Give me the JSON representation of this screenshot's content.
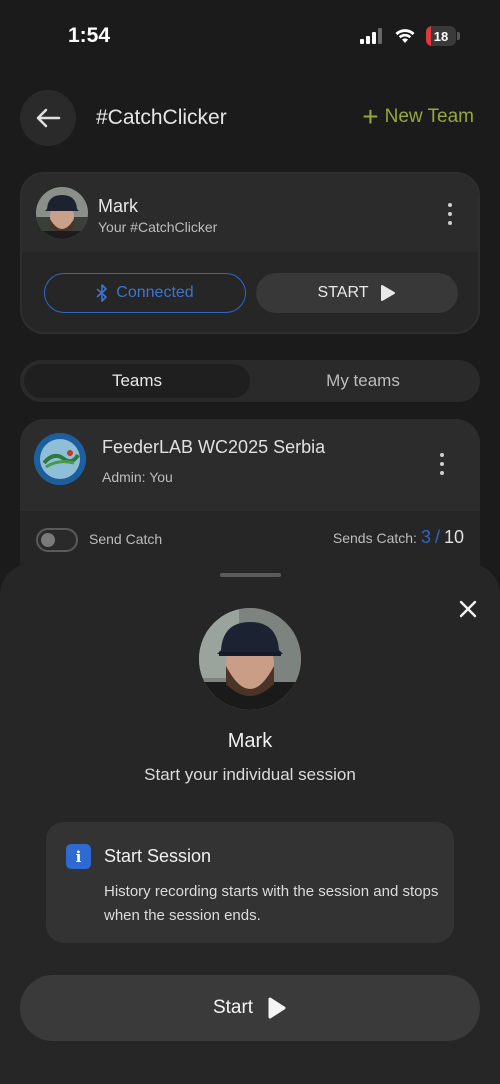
{
  "status_bar": {
    "time": "1:54",
    "battery_level": "18",
    "battery_fraction": 0.18,
    "icons": [
      "signal-icon",
      "wifi-icon",
      "battery-icon"
    ]
  },
  "header": {
    "back_icon": "arrow-left-icon",
    "title": "#CatchClicker",
    "new_team_label": "New Team",
    "accent_color": "#95a83b"
  },
  "user_card": {
    "name": "Mark",
    "subtitle": "Your #CatchClicker",
    "connected_label": "Connected",
    "connected_color": "#2f69c2",
    "start_label": "START"
  },
  "tabs": [
    {
      "label": "Teams",
      "active": true
    },
    {
      "label": "My teams",
      "active": false
    }
  ],
  "team": {
    "name": "FeederLAB WC2025 Serbia",
    "admin": "Admin: You",
    "send_catch_label": "Send Catch",
    "send_catch_enabled": false,
    "sends_catch_label": "Sends Catch:",
    "sends_count": "3",
    "sends_separator": "/",
    "sends_total": "10"
  },
  "sheet": {
    "name": "Mark",
    "subtitle": "Start your individual session",
    "info_title": "Start Session",
    "info_text": "History recording starts with the session and stops when the session ends.",
    "start_label": "Start"
  }
}
